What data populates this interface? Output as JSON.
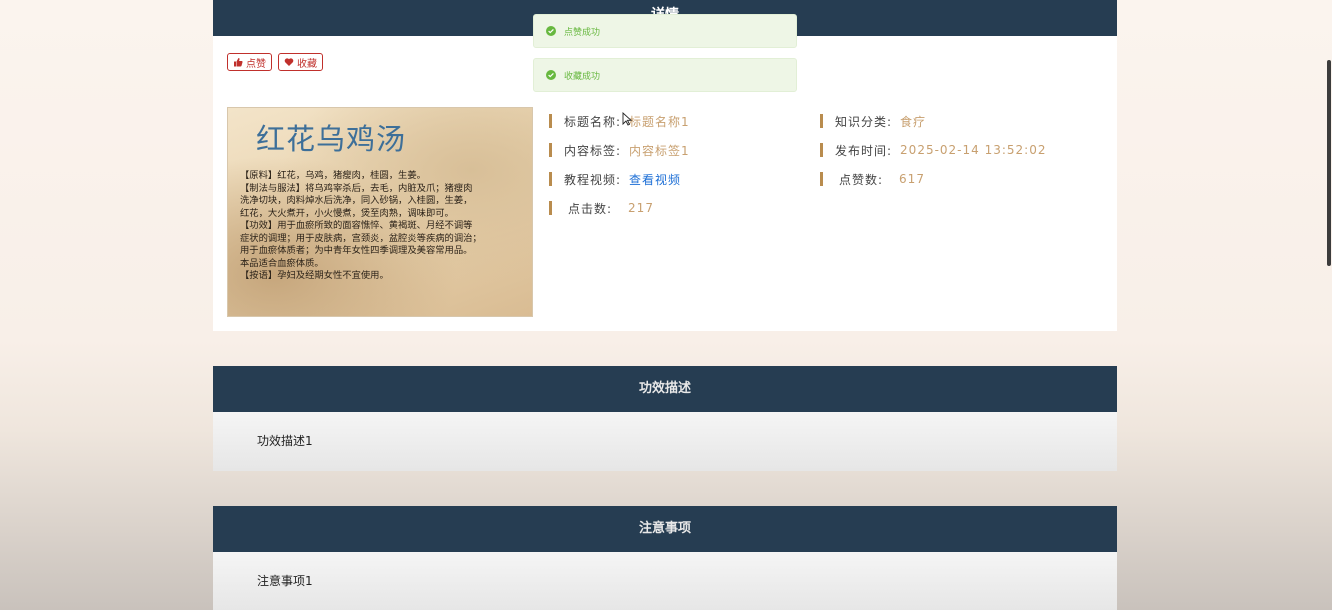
{
  "detail": {
    "header": "详情",
    "like_label": "点赞",
    "fav_label": "收藏",
    "cover_title": "红花乌鸡汤",
    "cover_lines": [
      "【原料】红花，乌鸡，猪瘦肉，桂圆，生姜。",
      "【制法与服法】将乌鸡宰杀后，去毛，内脏及爪；猪瘦肉",
      "洗净切块，肉料焯水后洗净，同入砂锅，入桂圆，生姜，",
      "红花，大火煮开，小火慢煮，煲至肉熟，调味即可。",
      "【功效】用于血瘀所致的面容憔悴、黄褐斑、月经不调等",
      "症状的调理；用于皮肤病，宫颈炎，盆腔炎等疾病的调治；",
      "用于血瘀体质者；为中青年女性四季调理及美容常用品。",
      "本品适合血瘀体质。",
      "【按语】孕妇及经期女性不宜使用。"
    ],
    "fields": {
      "title_label": "标题名称:",
      "title_value": "标题名称1",
      "tag_label": "内容标签:",
      "tag_value": "内容标签1",
      "video_label": "教程视频:",
      "video_link": "查看视频",
      "clicks_label": "点击数:",
      "clicks_value": "217",
      "category_label": "知识分类:",
      "category_value": "食疗",
      "publish_label": "发布时间:",
      "publish_value": "2025-02-14 13:52:02",
      "likes_label": "点赞数:",
      "likes_value": "617"
    }
  },
  "toasts": [
    {
      "text": "点赞成功"
    },
    {
      "text": "收藏成功"
    }
  ],
  "sections": [
    {
      "title": "功效描述",
      "body": "功效描述1"
    },
    {
      "title": "注意事项",
      "body": "注意事项1"
    }
  ],
  "colors": {
    "header_bg": "#263d52",
    "accent_bar": "#b98c4e",
    "value_text": "#c8a070",
    "link": "#1d6fd6",
    "success": "#67b83f"
  }
}
